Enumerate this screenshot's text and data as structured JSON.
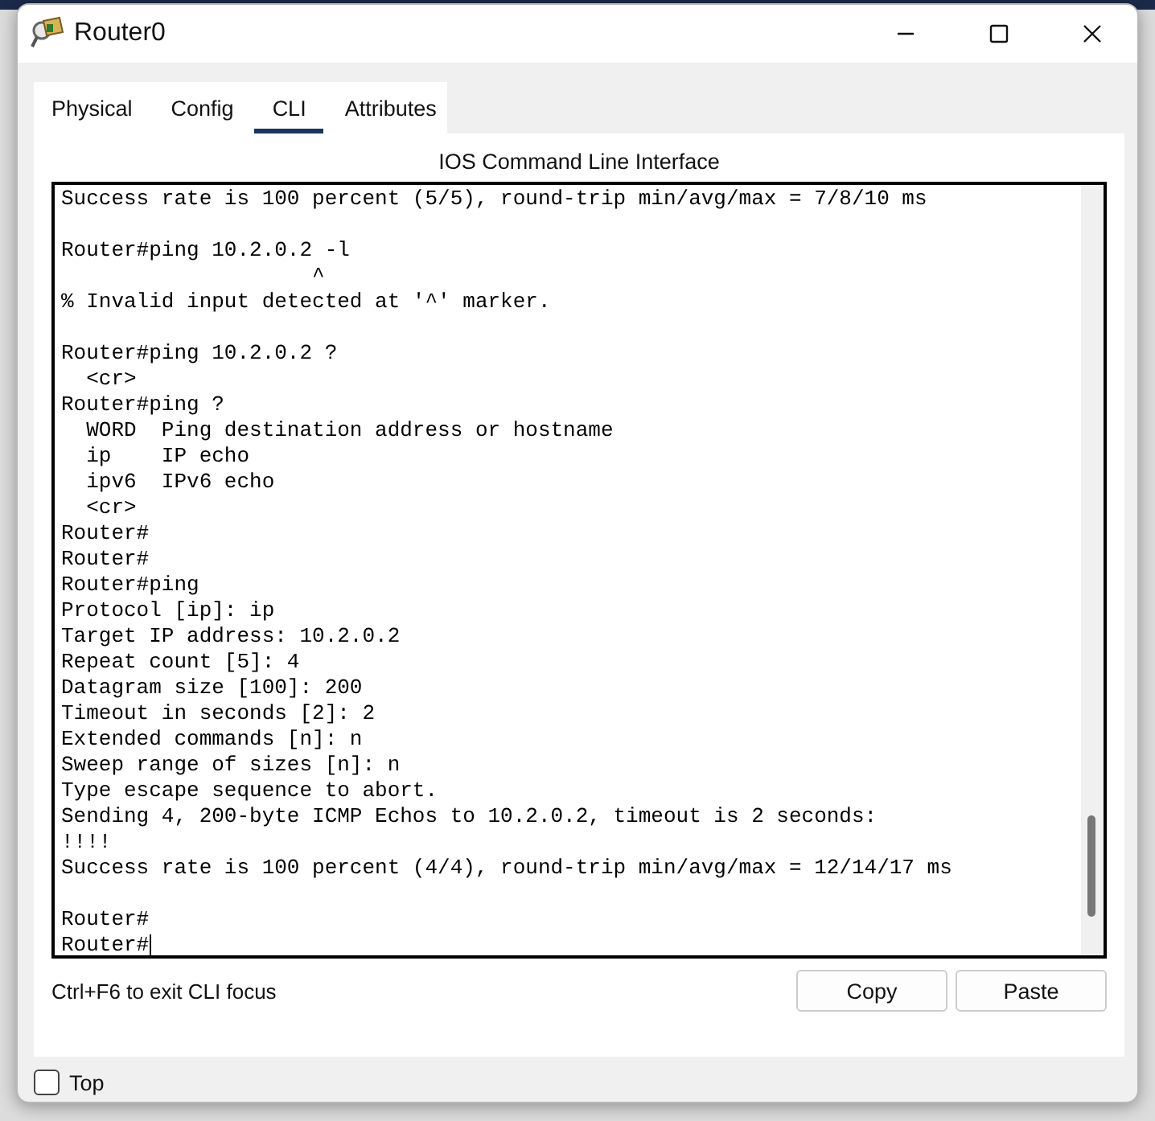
{
  "window": {
    "title": "Router0"
  },
  "tabs": [
    {
      "label": "Physical",
      "selected": false
    },
    {
      "label": "Config",
      "selected": false
    },
    {
      "label": "CLI",
      "selected": true
    },
    {
      "label": "Attributes",
      "selected": false
    }
  ],
  "panel_title": "IOS Command Line Interface",
  "terminal": {
    "lines": [
      {
        "text": "Success rate is 100 percent (5/5), round-trip min/avg/max = 7/8/10 ms",
        "blank_after": true
      },
      {
        "text": "Router#ping 10.2.0.2 -l",
        "blank_after": false
      },
      {
        "text": "                    ^",
        "blank_after": false
      },
      {
        "text": "% Invalid input detected at '^' marker.",
        "blank_after": true
      },
      {
        "text": "Router#ping 10.2.0.2 ?",
        "blank_after": false
      },
      {
        "text": "  <cr>",
        "blank_after": false
      },
      {
        "text": "Router#ping ?",
        "blank_after": false
      },
      {
        "text": "  WORD  Ping destination address or hostname",
        "blank_after": false
      },
      {
        "text": "  ip    IP echo",
        "blank_after": false
      },
      {
        "text": "  ipv6  IPv6 echo",
        "blank_after": false
      },
      {
        "text": "  <cr>",
        "blank_after": false
      },
      {
        "text": "Router#",
        "blank_after": false
      },
      {
        "text": "Router#",
        "blank_after": false
      },
      {
        "text": "Router#ping",
        "blank_after": false
      },
      {
        "text": "Protocol [ip]: ip",
        "blank_after": false
      },
      {
        "text": "Target IP address: 10.2.0.2",
        "blank_after": false
      },
      {
        "text": "Repeat count [5]: 4",
        "blank_after": false
      },
      {
        "text": "Datagram size [100]: 200",
        "blank_after": false
      },
      {
        "text": "Timeout in seconds [2]: 2",
        "blank_after": false
      },
      {
        "text": "Extended commands [n]: n",
        "blank_after": false
      },
      {
        "text": "Sweep range of sizes [n]: n",
        "blank_after": false
      },
      {
        "text": "Type escape sequence to abort.",
        "blank_after": false
      },
      {
        "text": "Sending 4, 200-byte ICMP Echos to 10.2.0.2, timeout is 2 seconds:",
        "blank_after": false
      },
      {
        "text": "!!!!",
        "blank_after": false
      },
      {
        "text": "Success rate is 100 percent (4/4), round-trip min/avg/max = 12/14/17 ms",
        "blank_after": true
      },
      {
        "text": "Router#",
        "blank_after": false
      },
      {
        "text": "Router#",
        "blank_after": false
      }
    ]
  },
  "hint": "Ctrl+F6 to exit CLI focus",
  "buttons": [
    "Copy",
    "Paste"
  ],
  "top_option": {
    "label": "Top",
    "checked": false
  }
}
